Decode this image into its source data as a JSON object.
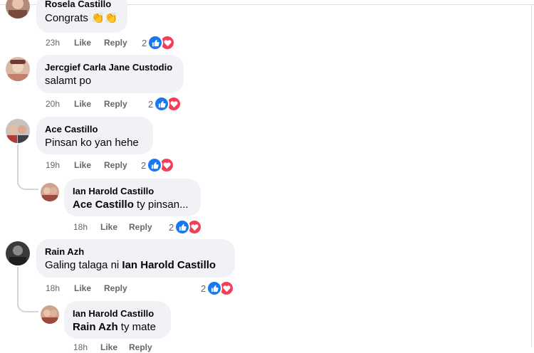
{
  "comments": [
    {
      "name": "Rosela Castillo",
      "text": "Congrats 👏👏",
      "time": "23h",
      "like": "Like",
      "reply": "Reply",
      "reactions": "2"
    },
    {
      "name": "Jercgief Carla Jane Custodio",
      "text": "salamt po",
      "time": "20h",
      "like": "Like",
      "reply": "Reply",
      "reactions": "2"
    },
    {
      "name": "Ace Castillo",
      "text": "Pinsan ko yan hehe",
      "time": "19h",
      "like": "Like",
      "reply": "Reply",
      "reactions": "2",
      "reply_comment": {
        "name": "Ian Harold Castillo",
        "tag": "Ace Castillo",
        "text": " ty pinsan...",
        "time": "18h",
        "like": "Like",
        "reply": "Reply",
        "reactions": "2"
      }
    },
    {
      "name": "Rain Azh",
      "text_prefix": "Galing talaga ni ",
      "tag": "Ian Harold Castillo",
      "time": "18h",
      "like": "Like",
      "reply": "Reply",
      "reactions": "2",
      "reply_comment": {
        "name": "Ian Harold Castillo",
        "tag": "Rain Azh",
        "text": " ty mate",
        "time": "18h",
        "like": "Like",
        "reply": "Reply"
      }
    }
  ],
  "icons": {
    "like_reaction": "thumbs-up-icon",
    "love_reaction": "heart-icon",
    "like_color": "#1877f2",
    "love_color": "#f33e58"
  }
}
